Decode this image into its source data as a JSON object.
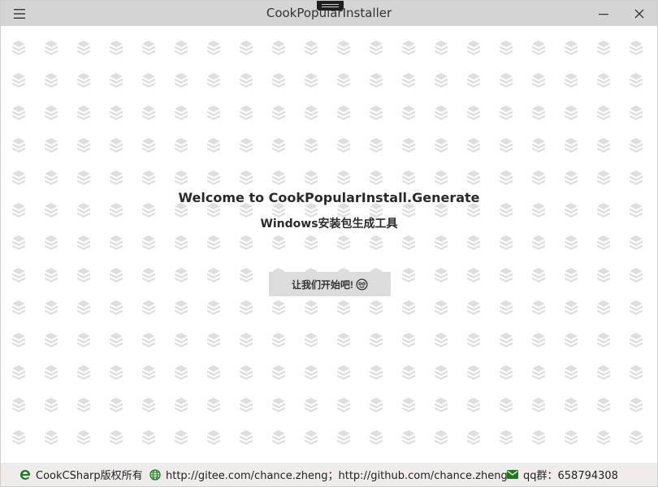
{
  "window": {
    "title": "CookPopularInstaller"
  },
  "main": {
    "welcome": "Welcome to CookPopularInstall.Generate",
    "subtitle": "Windows安装包生成工具",
    "start_button": "让我们开始吧!"
  },
  "statusbar": {
    "copyright": "CookCSharp版权所有",
    "links": "http://gitee.com/chance.zheng；http://github.com/chance.zheng",
    "qq": "qq群：658794308"
  },
  "colors": {
    "titlebar": "#d4d4d4",
    "pattern": "#dedede",
    "button": "#dcdcdc",
    "statusbar": "#f0ecec",
    "icon_green": "#1e7a1e"
  }
}
